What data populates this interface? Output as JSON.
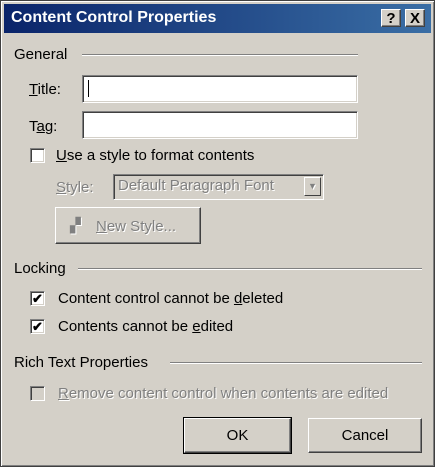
{
  "dialog": {
    "title": "Content Control Properties",
    "help_label": "?",
    "close_label": "X"
  },
  "general": {
    "section_label": "General",
    "title_label": {
      "pre": "",
      "u": "T",
      "post": "itle:"
    },
    "title_value": "",
    "tag_label": {
      "pre": "T",
      "u": "a",
      "post": "g:"
    },
    "tag_value": "",
    "use_style": {
      "pre": "",
      "u": "U",
      "post": "se a style to format contents",
      "checked": false
    },
    "style_label": {
      "pre": "",
      "u": "S",
      "post": "tyle:"
    },
    "style_value": "Default Paragraph Font",
    "new_style_button": {
      "pre": "",
      "u": "N",
      "post": "ew Style..."
    }
  },
  "locking": {
    "section_label": "Locking",
    "cannot_delete": {
      "pre": "Content control cannot be ",
      "u": "d",
      "post": "eleted",
      "checked": true
    },
    "cannot_edit": {
      "pre": "Contents cannot be ",
      "u": "e",
      "post": "dited",
      "checked": true
    }
  },
  "rich_text": {
    "section_label": "Rich Text Properties",
    "remove_when_edited": {
      "pre": "",
      "u": "R",
      "post": "emove content control when contents are edited",
      "checked": false
    }
  },
  "buttons": {
    "ok": "OK",
    "cancel": "Cancel"
  },
  "icons": {
    "check": "✔",
    "dropdown_arrow": "▼",
    "new_style_icon": "▞"
  }
}
